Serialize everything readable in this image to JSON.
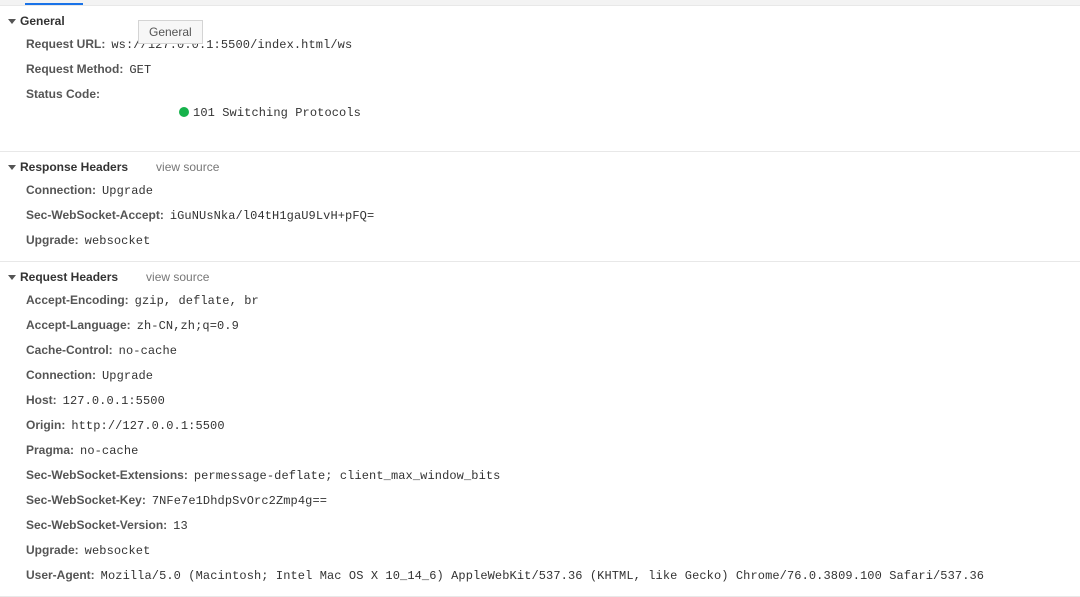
{
  "tooltip": "General",
  "general": {
    "title": "General",
    "requestUrl": {
      "label": "Request URL:",
      "value": "ws://127.0.0.1:5500/index.html/ws"
    },
    "requestMethod": {
      "label": "Request Method:",
      "value": "GET"
    },
    "statusCode": {
      "label": "Status Code:",
      "value": "101 Switching Protocols"
    }
  },
  "responseHeaders": {
    "title": "Response Headers",
    "viewSource": "view source",
    "items": [
      {
        "label": "Connection:",
        "value": "Upgrade"
      },
      {
        "label": "Sec-WebSocket-Accept:",
        "value": "iGuNUsNka/l04tH1gaU9LvH+pFQ="
      },
      {
        "label": "Upgrade:",
        "value": "websocket"
      }
    ]
  },
  "requestHeaders": {
    "title": "Request Headers",
    "viewSource": "view source",
    "items": [
      {
        "label": "Accept-Encoding:",
        "value": "gzip, deflate, br"
      },
      {
        "label": "Accept-Language:",
        "value": "zh-CN,zh;q=0.9"
      },
      {
        "label": "Cache-Control:",
        "value": "no-cache"
      },
      {
        "label": "Connection:",
        "value": "Upgrade"
      },
      {
        "label": "Host:",
        "value": "127.0.0.1:5500"
      },
      {
        "label": "Origin:",
        "value": "http://127.0.0.1:5500"
      },
      {
        "label": "Pragma:",
        "value": "no-cache"
      },
      {
        "label": "Sec-WebSocket-Extensions:",
        "value": "permessage-deflate; client_max_window_bits"
      },
      {
        "label": "Sec-WebSocket-Key:",
        "value": "7NFe7e1DhdpSvOrc2Zmp4g=="
      },
      {
        "label": "Sec-WebSocket-Version:",
        "value": "13"
      },
      {
        "label": "Upgrade:",
        "value": "websocket"
      },
      {
        "label": "User-Agent:",
        "value": "Mozilla/5.0 (Macintosh; Intel Mac OS X 10_14_6) AppleWebKit/537.36 (KHTML, like Gecko) Chrome/76.0.3809.100 Safari/537.36"
      }
    ]
  }
}
